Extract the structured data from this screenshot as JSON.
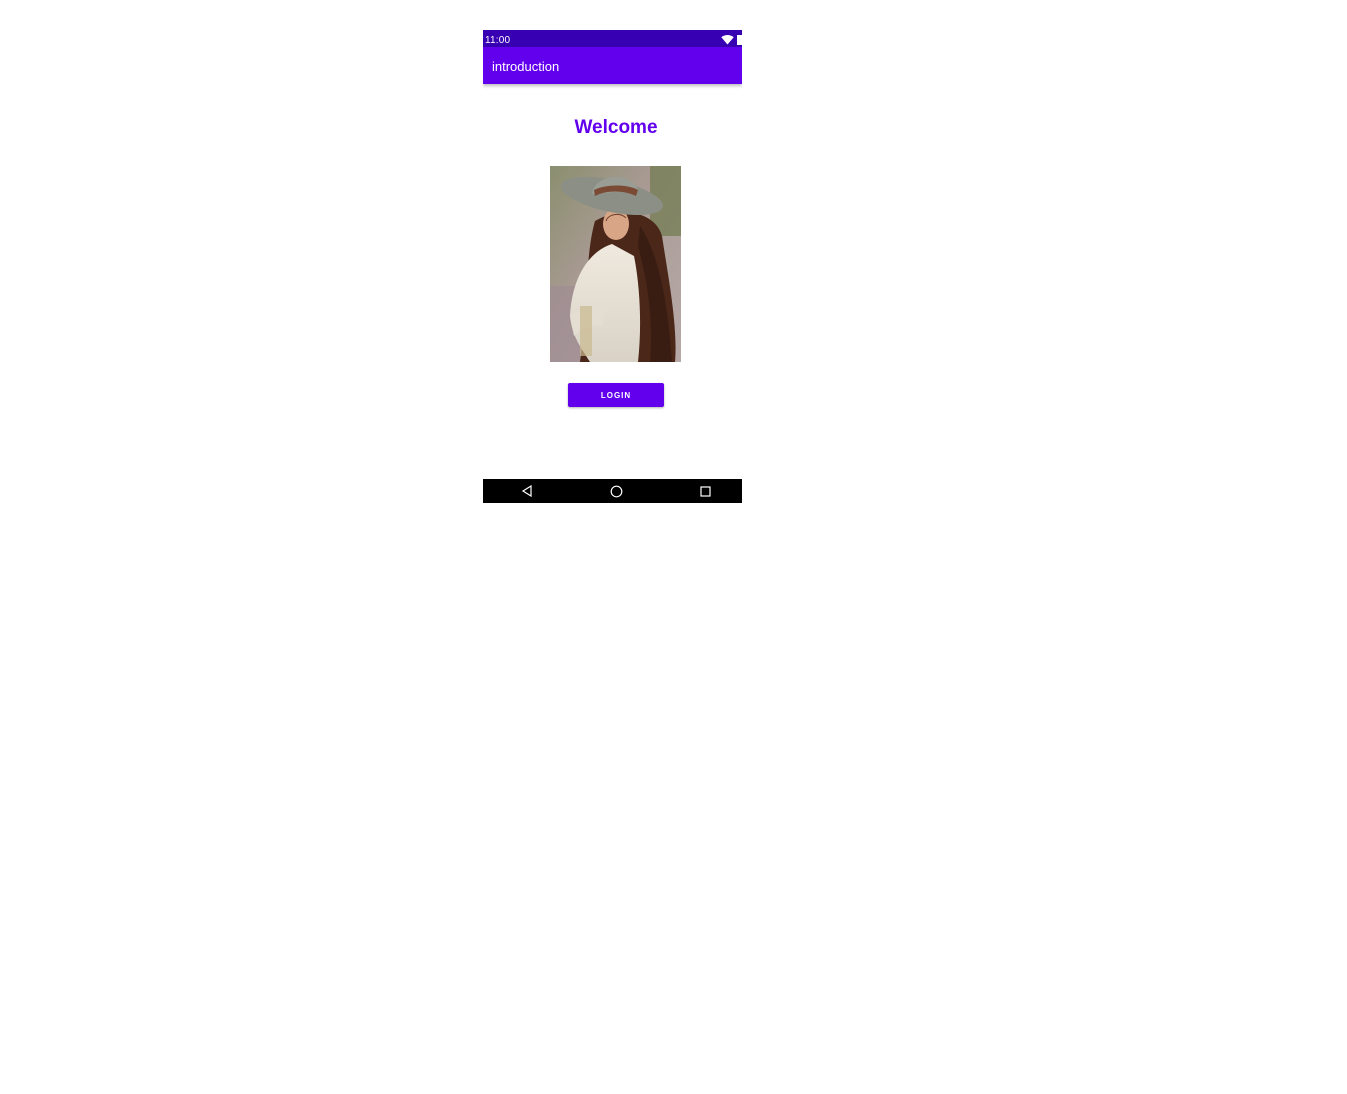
{
  "status_bar": {
    "time": "11:00",
    "icons": [
      "wifi-icon",
      "battery-icon"
    ]
  },
  "app_bar": {
    "title": "introduction"
  },
  "main": {
    "heading": "Welcome",
    "image": {
      "alt": "woman-with-hat-photo"
    },
    "login_button_label": "LOGIN"
  },
  "nav_bar": {
    "buttons": [
      "back-icon",
      "home-icon",
      "recents-icon"
    ]
  },
  "colors": {
    "primary": "#6200ee",
    "primary_dark": "#3700b3",
    "nav_bar": "#000000",
    "background": "#ffffff"
  }
}
